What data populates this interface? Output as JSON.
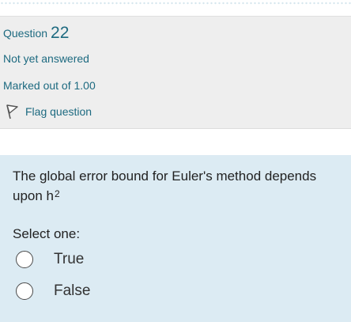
{
  "question": {
    "word": "Question",
    "number": "22",
    "state": "Not yet answered",
    "grade": "Marked out of 1.00",
    "flag_label": "Flag question",
    "flag_icon": "flag-icon"
  },
  "formulation": {
    "text_main": "The global error bound for Euler's method depends upon h",
    "text_sup": "2",
    "prompt": "Select one:",
    "options": [
      {
        "label": "True",
        "selected": false
      },
      {
        "label": "False",
        "selected": false
      }
    ]
  },
  "colors": {
    "link": "#1d6a80",
    "info_bg": "#eeeeee",
    "formulation_bg": "#dcebf3"
  }
}
